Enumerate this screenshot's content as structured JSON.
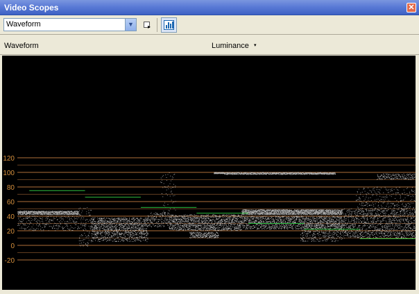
{
  "window": {
    "title": "Video Scopes",
    "close_glyph": "✕"
  },
  "toolbar": {
    "scope_select": {
      "value": "Waveform",
      "arrow_icon": "chevron-down-icon"
    },
    "pointer_button_icon": "cursor-select-icon",
    "histogram_button_icon": "histogram-icon"
  },
  "header": {
    "scope_label": "Waveform",
    "mode_label": "Luminance",
    "mode_arrow": "▾"
  },
  "scope": {
    "grid_color": "#b0703a",
    "label_color": "#d9923e",
    "trace_color": "#e6e6e6",
    "marker_color": "#2fbf3f",
    "ylim": [
      -25,
      125
    ],
    "y_ticks": [
      -20,
      0,
      20,
      40,
      60,
      80,
      100,
      120
    ],
    "markers": [
      {
        "from": 0.03,
        "to": 0.17,
        "level": 75
      },
      {
        "from": 0.17,
        "to": 0.31,
        "level": 66
      },
      {
        "from": 0.31,
        "to": 0.45,
        "level": 52
      },
      {
        "from": 0.45,
        "to": 0.58,
        "level": 44
      },
      {
        "from": 0.58,
        "to": 0.72,
        "level": 30
      },
      {
        "from": 0.72,
        "to": 0.86,
        "level": 22
      },
      {
        "from": 0.86,
        "to": 1.0,
        "level": 9
      }
    ]
  }
}
